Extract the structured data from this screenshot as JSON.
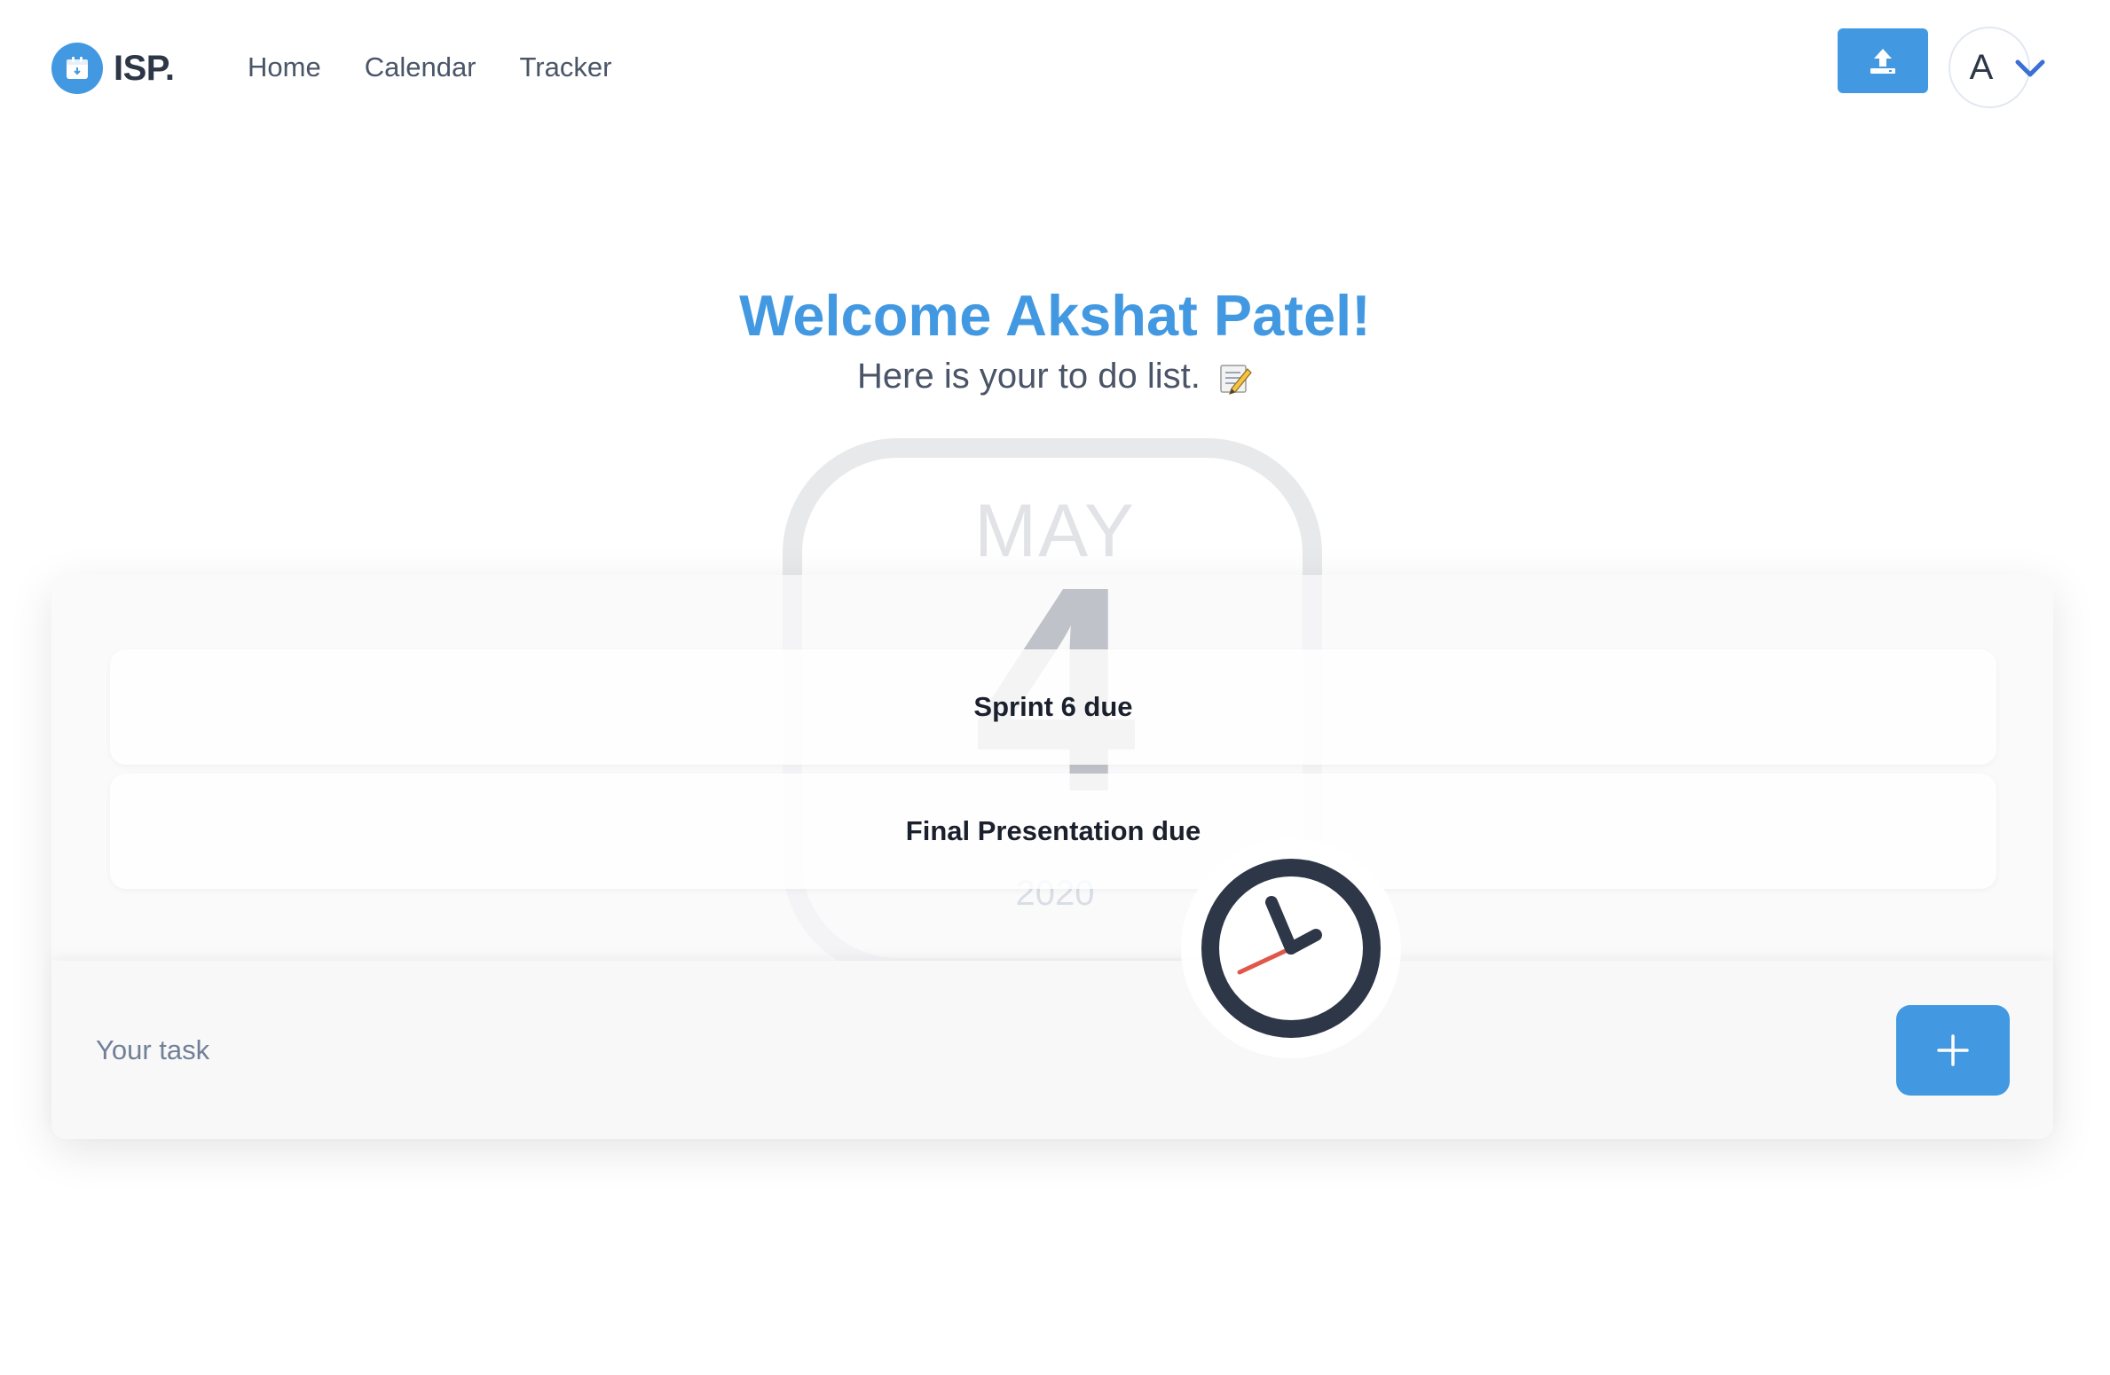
{
  "app": {
    "logo_text": "ISP.",
    "logo_icon": "calendar-icon",
    "accent_color": "#4299e1"
  },
  "nav": {
    "items": [
      {
        "label": "Home"
      },
      {
        "label": "Calendar"
      },
      {
        "label": "Tracker"
      }
    ]
  },
  "header": {
    "upload_icon": "upload-icon",
    "avatar_letter": "A",
    "avatar_menu_icon": "chevron-down-icon"
  },
  "hero": {
    "welcome": "Welcome Akshat Patel!",
    "subtitle": "Here is your to do list.",
    "subtitle_icon": "memo-icon"
  },
  "calendar_illustration": {
    "month": "MAY",
    "day": "4",
    "year": "2020"
  },
  "todos": {
    "items": [
      {
        "title": "Sprint 6 due"
      },
      {
        "title": "Final Presentation due"
      }
    ]
  },
  "task_form": {
    "placeholder": "Your task",
    "add_icon": "plus-icon"
  },
  "illustration": {
    "clock_icon": "clock-icon"
  }
}
